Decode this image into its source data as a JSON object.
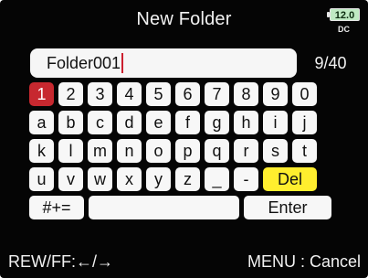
{
  "header": {
    "title": "New Folder",
    "battery": "12.0",
    "power": "DC"
  },
  "name_field": {
    "value": "Folder001",
    "counter": "9/40"
  },
  "keyboard": {
    "rows": [
      [
        "1",
        "2",
        "3",
        "4",
        "5",
        "6",
        "7",
        "8",
        "9",
        "0"
      ],
      [
        "a",
        "b",
        "c",
        "d",
        "e",
        "f",
        "g",
        "h",
        "i",
        "j"
      ],
      [
        "k",
        "l",
        "m",
        "n",
        "o",
        "p",
        "q",
        "r",
        "s",
        "t"
      ],
      [
        "u",
        "v",
        "w",
        "x",
        "y",
        "z",
        "_",
        "-"
      ]
    ],
    "del_label": "Del",
    "symbols_label": "#+=",
    "space_label": "",
    "enter_label": "Enter",
    "selected_key": "1"
  },
  "footer": {
    "left_hint": "REW/FF:←/→",
    "right_hint": "MENU : Cancel"
  },
  "colors": {
    "selected_key": "#c7282f",
    "del_key": "#ffee2e",
    "cursor": "#cc1f2f",
    "battery": "#bfeac3"
  }
}
